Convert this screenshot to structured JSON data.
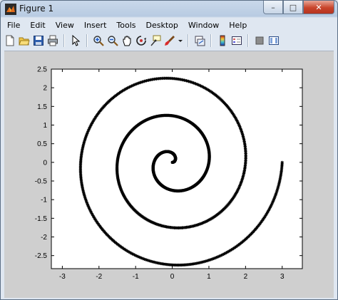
{
  "window": {
    "title": "Figure 1",
    "minimize": "–",
    "maximize": "□",
    "close": "✕"
  },
  "menu": [
    "File",
    "Edit",
    "View",
    "Insert",
    "Tools",
    "Desktop",
    "Window",
    "Help"
  ],
  "toolbar": [
    "new-figure-icon",
    "open-file-icon",
    "save-icon",
    "print-icon",
    "pointer-icon",
    "zoom-in-icon",
    "zoom-out-icon",
    "pan-icon",
    "rotate-3d-icon",
    "data-cursor-icon",
    "brush-icon",
    "link-plot-icon",
    "insert-colorbar-icon",
    "insert-legend-icon",
    "hide-plot-tools-icon",
    "show-plot-tools-icon"
  ],
  "chart_data": {
    "type": "line",
    "description_of_series": "Archimedean spiral r = t/(2*pi), t from 0 to 6*pi, plotted with '*' markers",
    "spiral": {
      "t_start": 0,
      "t_end": 18.8496,
      "radius_per_radian": 0.159155
    },
    "marker": "*",
    "color": "#000000",
    "xlim": [
      -3.3,
      3.55
    ],
    "ylim": [
      -2.85,
      2.5
    ],
    "xticks": [
      "-3",
      "-2",
      "-1",
      "0",
      "1",
      "2",
      "3"
    ],
    "xtick_values": [
      -3,
      -2,
      -1,
      0,
      1,
      2,
      3
    ],
    "yticks": [
      "2.5",
      "2",
      "1.5",
      "1",
      "0.5",
      "0",
      "-0.5",
      "-1",
      "-1.5",
      "-2",
      "-2.5"
    ],
    "ytick_values": [
      2.5,
      2,
      1.5,
      1,
      0.5,
      0,
      -0.5,
      -1,
      -1.5,
      -2,
      -2.5
    ]
  }
}
